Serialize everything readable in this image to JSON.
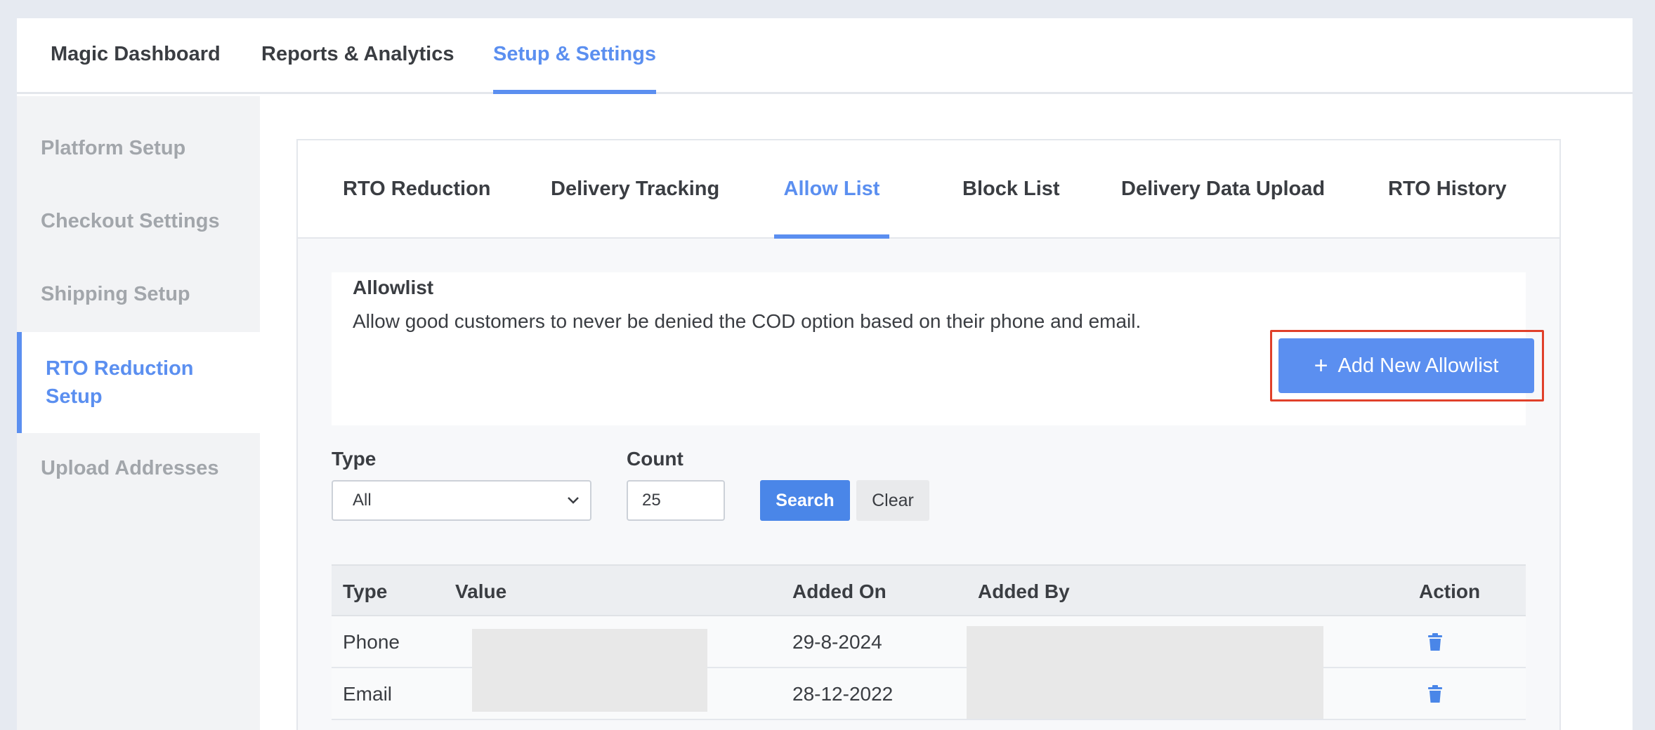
{
  "topnav": {
    "tabs": [
      {
        "label": "Magic Dashboard"
      },
      {
        "label": "Reports & Analytics"
      },
      {
        "label": "Setup & Settings"
      }
    ]
  },
  "sidebar": {
    "items": [
      {
        "label": "Platform Setup"
      },
      {
        "label": "Checkout Settings"
      },
      {
        "label": "Shipping Setup"
      },
      {
        "label": "RTO Reduction Setup"
      },
      {
        "label": "Upload Addresses"
      }
    ]
  },
  "subtabs": [
    {
      "label": "RTO Reduction"
    },
    {
      "label": "Delivery Tracking"
    },
    {
      "label": "Allow List"
    },
    {
      "label": "Block List"
    },
    {
      "label": "Delivery Data Upload"
    },
    {
      "label": "RTO History"
    }
  ],
  "card": {
    "title": "Allowlist",
    "description": "Allow good customers to never be denied the COD option based on their phone and email.",
    "add_button_label": "Add New Allowlist"
  },
  "filters": {
    "type_label": "Type",
    "type_value": "All",
    "count_label": "Count",
    "count_value": "25",
    "search_label": "Search",
    "clear_label": "Clear"
  },
  "table": {
    "headers": [
      "Type",
      "Value",
      "Added On",
      "Added By",
      "Action"
    ],
    "rows": [
      {
        "type": "Phone",
        "added_on": "29-8-2024"
      },
      {
        "type": "Email",
        "added_on": "28-12-2022"
      }
    ]
  },
  "colors": {
    "accent": "#5b8ff0",
    "highlight_outline": "#e0402a"
  }
}
